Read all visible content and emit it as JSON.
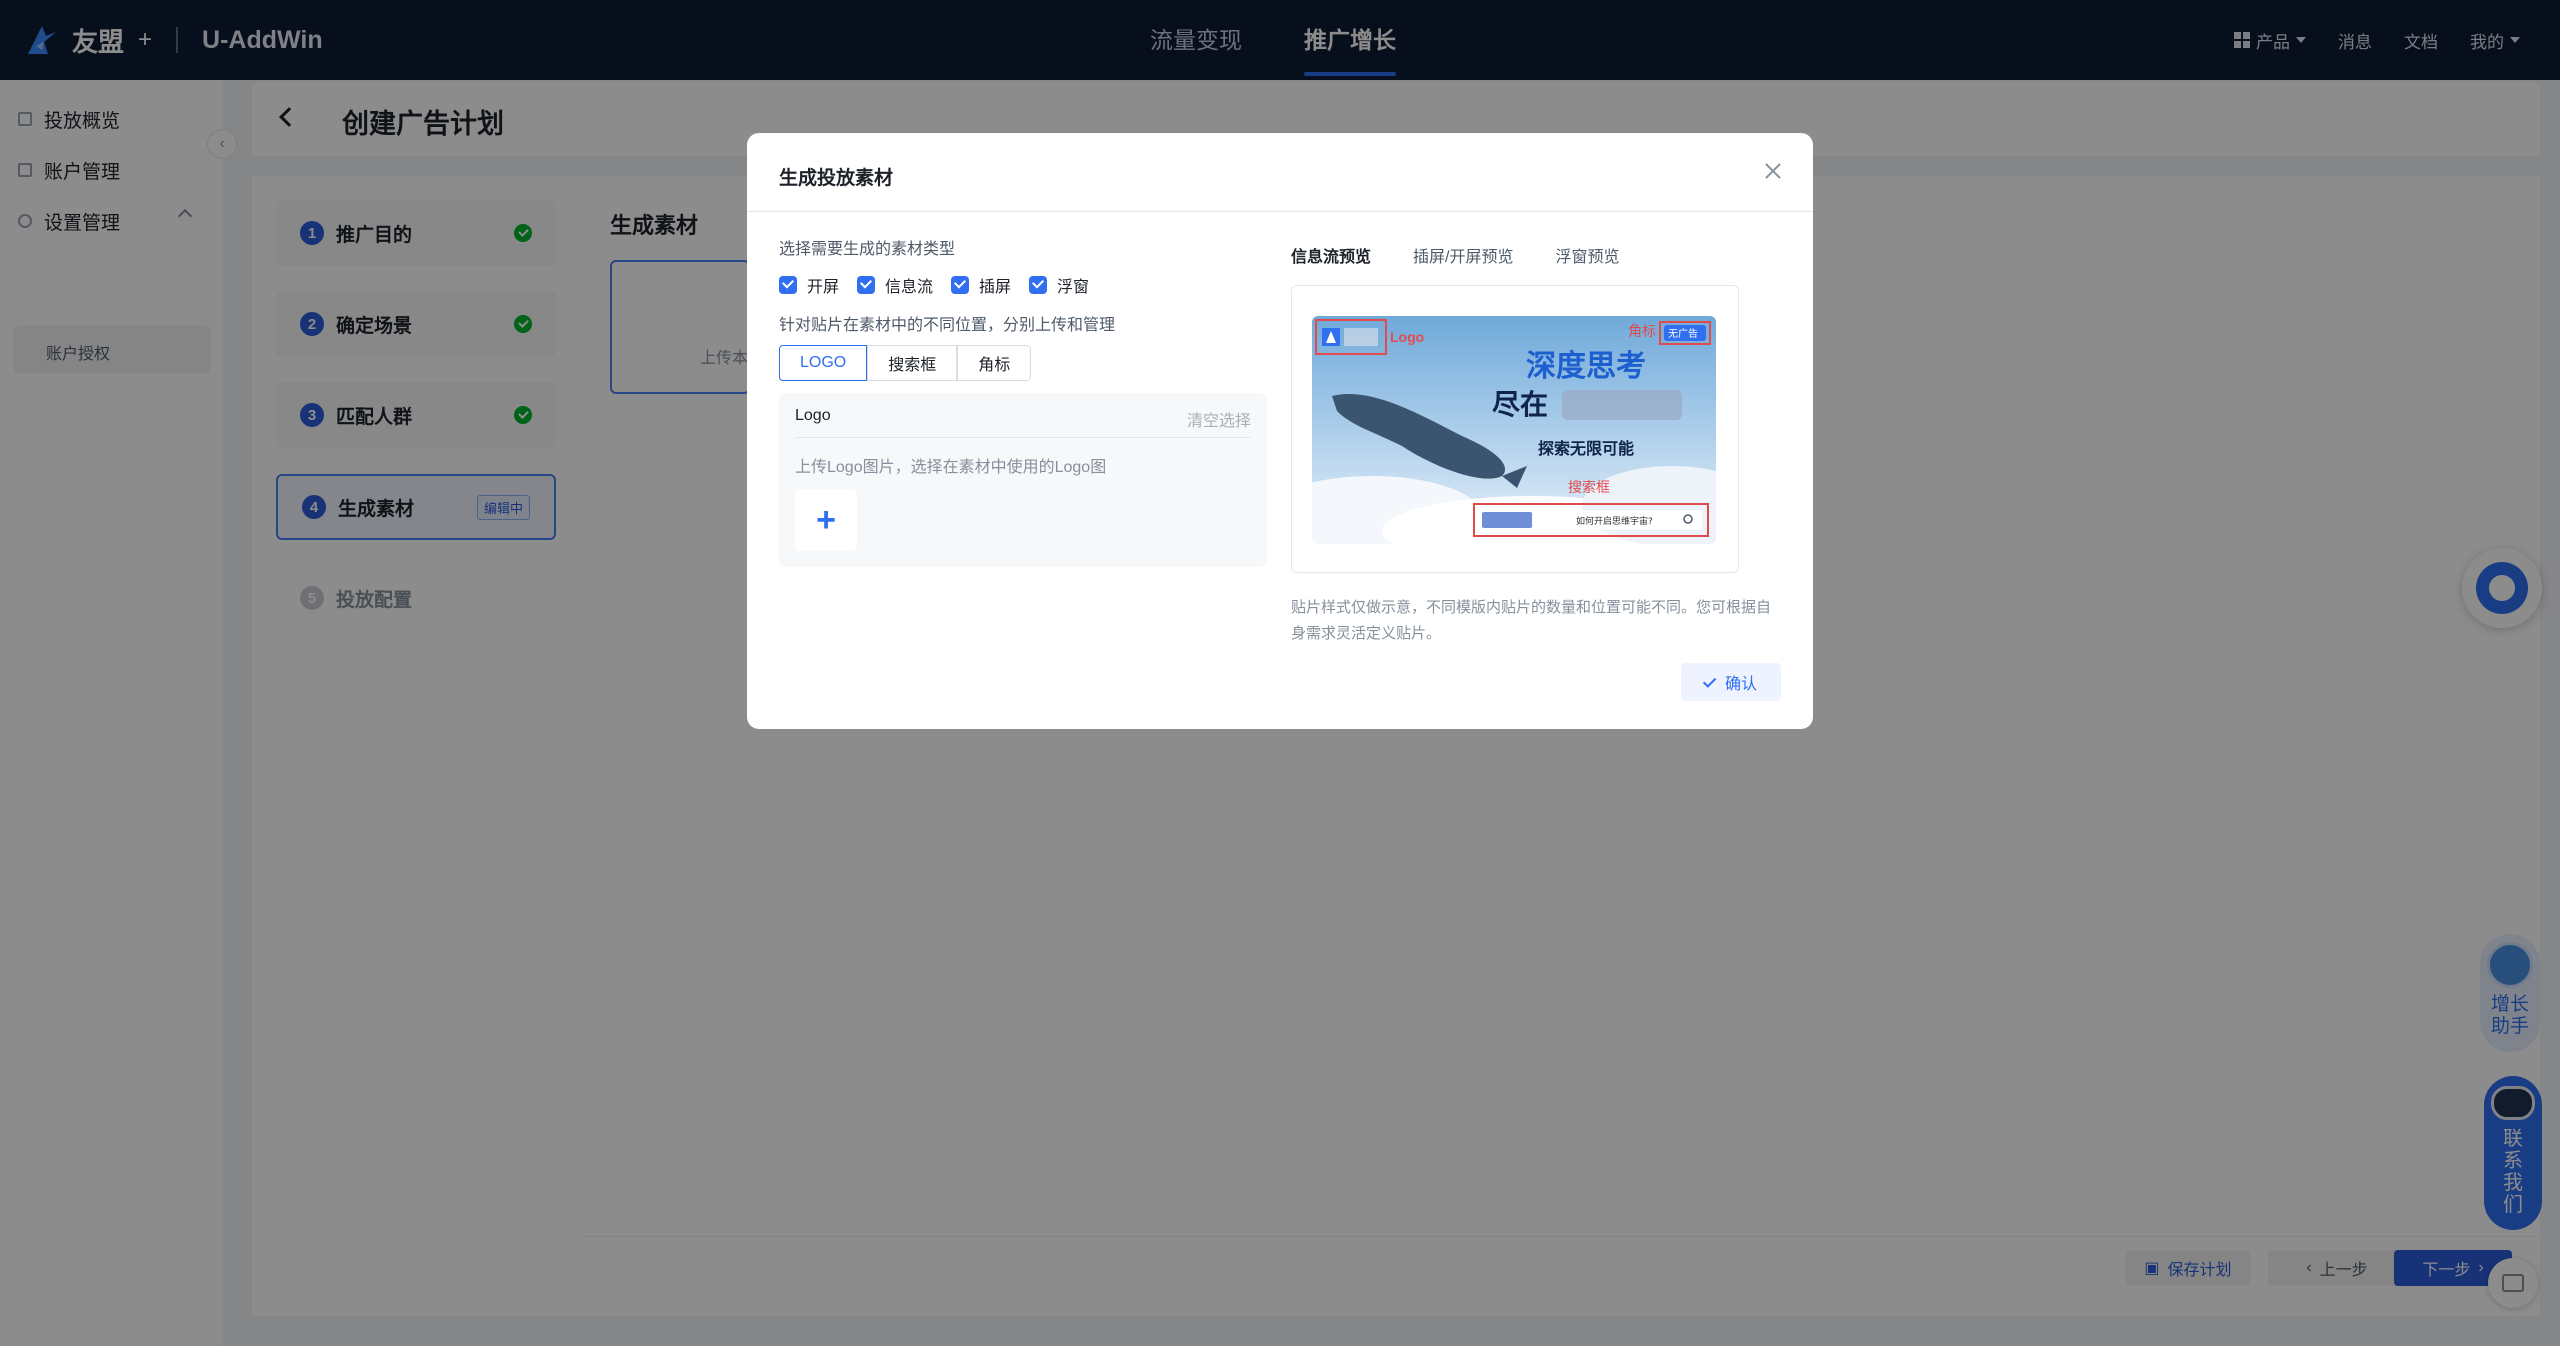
{
  "topnav": {
    "brand": "友盟",
    "brand_plus": "+",
    "product": "U-AddWin",
    "tabs": [
      {
        "label": "流量变现",
        "active": false
      },
      {
        "label": "推广增长",
        "active": true
      }
    ],
    "right": {
      "product_menu": "产品",
      "messages": "消息",
      "docs": "文档",
      "mine": "我的"
    }
  },
  "sidebar": {
    "items": [
      {
        "label": "投放概览",
        "icon": "list-icon"
      },
      {
        "label": "账户管理",
        "icon": "list-icon"
      },
      {
        "label": "设置管理",
        "icon": "gear-icon"
      }
    ],
    "sub_item": "账户授权"
  },
  "page": {
    "title": "创建广告计划",
    "section_title": "生成素材",
    "upload_hint": "上传本"
  },
  "steps": [
    {
      "num": "1",
      "label": "推广目的",
      "status": "done"
    },
    {
      "num": "2",
      "label": "确定场景",
      "status": "done"
    },
    {
      "num": "3",
      "label": "匹配人群",
      "status": "done"
    },
    {
      "num": "4",
      "label": "生成素材",
      "status": "editing",
      "tag": "编辑中"
    },
    {
      "num": "5",
      "label": "投放配置",
      "status": "pending"
    }
  ],
  "footer": {
    "save": "保存计划",
    "prev": "上一步",
    "next": "下一步"
  },
  "widgets": {
    "growth_helper": "增长助手",
    "contact_us": "联系我们"
  },
  "modal": {
    "title": "生成投放素材",
    "type_label": "选择需要生成的素材类型",
    "types": [
      {
        "label": "开屏",
        "checked": true
      },
      {
        "label": "信息流",
        "checked": true
      },
      {
        "label": "插屏",
        "checked": true
      },
      {
        "label": "浮窗",
        "checked": true
      }
    ],
    "patch_label": "针对贴片在素材中的不同位置，分别上传和管理",
    "segments": [
      {
        "label": "LOGO",
        "active": true
      },
      {
        "label": "搜索框",
        "active": false
      },
      {
        "label": "角标",
        "active": false
      }
    ],
    "logo_panel": {
      "title": "Logo",
      "clear": "清空选择",
      "hint": "上传Logo图片，选择在素材中使用的Logo图",
      "add": "+"
    },
    "preview_tabs": [
      {
        "label": "信息流预览",
        "active": true
      },
      {
        "label": "插屏/开屏预览",
        "active": false
      },
      {
        "label": "浮窗预览",
        "active": false
      }
    ],
    "preview": {
      "logo": "Logo",
      "corner": "角标",
      "ad_tag": "无广告",
      "headline": "深度思考",
      "subline": "尽在",
      "tagline": "探索无限可能",
      "search_label": "搜索框",
      "search_text": "如何开启思维宇宙?"
    },
    "note": "贴片样式仅做示意，不同模版内贴片的数量和位置可能不同。您可根据自身需求灵活定义贴片。",
    "confirm": "确认"
  },
  "colors": {
    "primary": "#2f6ff0",
    "nav_bg": "#0e1a33",
    "success": "#00b42a"
  }
}
